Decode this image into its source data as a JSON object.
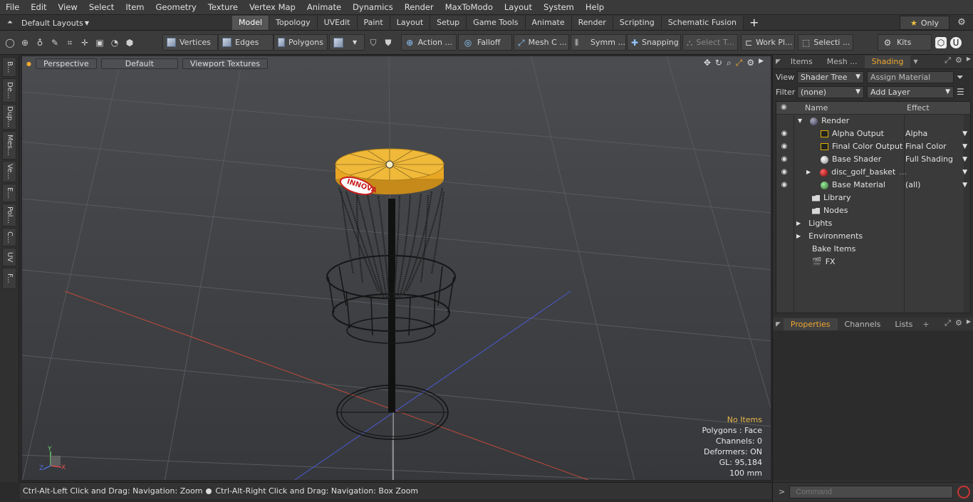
{
  "menubar": [
    "File",
    "Edit",
    "View",
    "Select",
    "Item",
    "Geometry",
    "Texture",
    "Vertex Map",
    "Animate",
    "Dynamics",
    "Render",
    "MaxToModo",
    "Layout",
    "System",
    "Help"
  ],
  "layoutbar": {
    "layout_label": "Default Layouts",
    "tabs": [
      "Model",
      "Topology",
      "UVEdit",
      "Paint",
      "Layout",
      "Setup",
      "Game Tools",
      "Animate",
      "Render",
      "Scripting",
      "Schematic Fusion"
    ],
    "active_tab": "Model",
    "only_label": "Only"
  },
  "toolbar": {
    "vertices": "Vertices",
    "edges": "Edges",
    "polygons": "Polygons",
    "action": "Action ...",
    "falloff": "Falloff",
    "mesh": "Mesh C ...",
    "symm": "Symm ...",
    "snapping": "Snapping",
    "select_t": "Select T...",
    "work_pl": "Work Pl...",
    "selecti": "Selecti ...",
    "kits": "Kits"
  },
  "lefttabs": [
    "B...",
    "De...",
    "Dup...",
    "Mes...",
    "Ve...",
    "E...",
    "Pol...",
    "C...",
    "UV",
    "F..."
  ],
  "viewport": {
    "view_type": "Perspective",
    "shading": "Default",
    "textures": "Viewport Textures",
    "info": {
      "no_items": "No Items",
      "polygons": "Polygons : Face",
      "channels": "Channels: 0",
      "deformers": "Deformers: ON",
      "gl": "GL: 95,184",
      "scale": "100 mm"
    },
    "axis_labels": {
      "y": "Y",
      "z": "Z",
      "x": "X"
    }
  },
  "statusbar": {
    "hint1": "Ctrl-Alt-Left Click and Drag: Navigation: Zoom",
    "hint2": "Ctrl-Alt-Right Click and Drag: Navigation: Box Zoom"
  },
  "rightpanel": {
    "top_tabs": [
      "Items",
      "Mesh ...",
      "Shading"
    ],
    "active_top_tab": "Shading",
    "view_label": "View",
    "view_value": "Shader Tree",
    "assign_material": "Assign Material",
    "filter_label": "Filter",
    "filter_value": "(none)",
    "add_layer": "Add Layer",
    "col_name": "Name",
    "col_effect": "Effect",
    "tree": [
      {
        "name": "Render",
        "effect": ""
      },
      {
        "name": "Alpha Output",
        "effect": "Alpha"
      },
      {
        "name": "Final Color Output",
        "effect": "Final Color"
      },
      {
        "name": "Base Shader",
        "effect": "Full Shading"
      },
      {
        "name": "disc_golf_basket",
        "effect": ""
      },
      {
        "name": "Base Material",
        "effect": "(all)"
      },
      {
        "name": "Library",
        "effect": ""
      },
      {
        "name": "Nodes",
        "effect": ""
      },
      {
        "name": "Lights",
        "effect": ""
      },
      {
        "name": "Environments",
        "effect": ""
      },
      {
        "name": "Bake Items",
        "effect": ""
      },
      {
        "name": "FX",
        "effect": ""
      }
    ],
    "bottom_tabs": [
      "Properties",
      "Channels",
      "Lists"
    ],
    "active_bottom_tab": "Properties",
    "command_placeholder": "Command"
  },
  "model_label": "INNOVA",
  "colors": {
    "accent": "#f0a830",
    "basket_yellow": "#e8a624",
    "basket_red": "#c81e1e"
  }
}
